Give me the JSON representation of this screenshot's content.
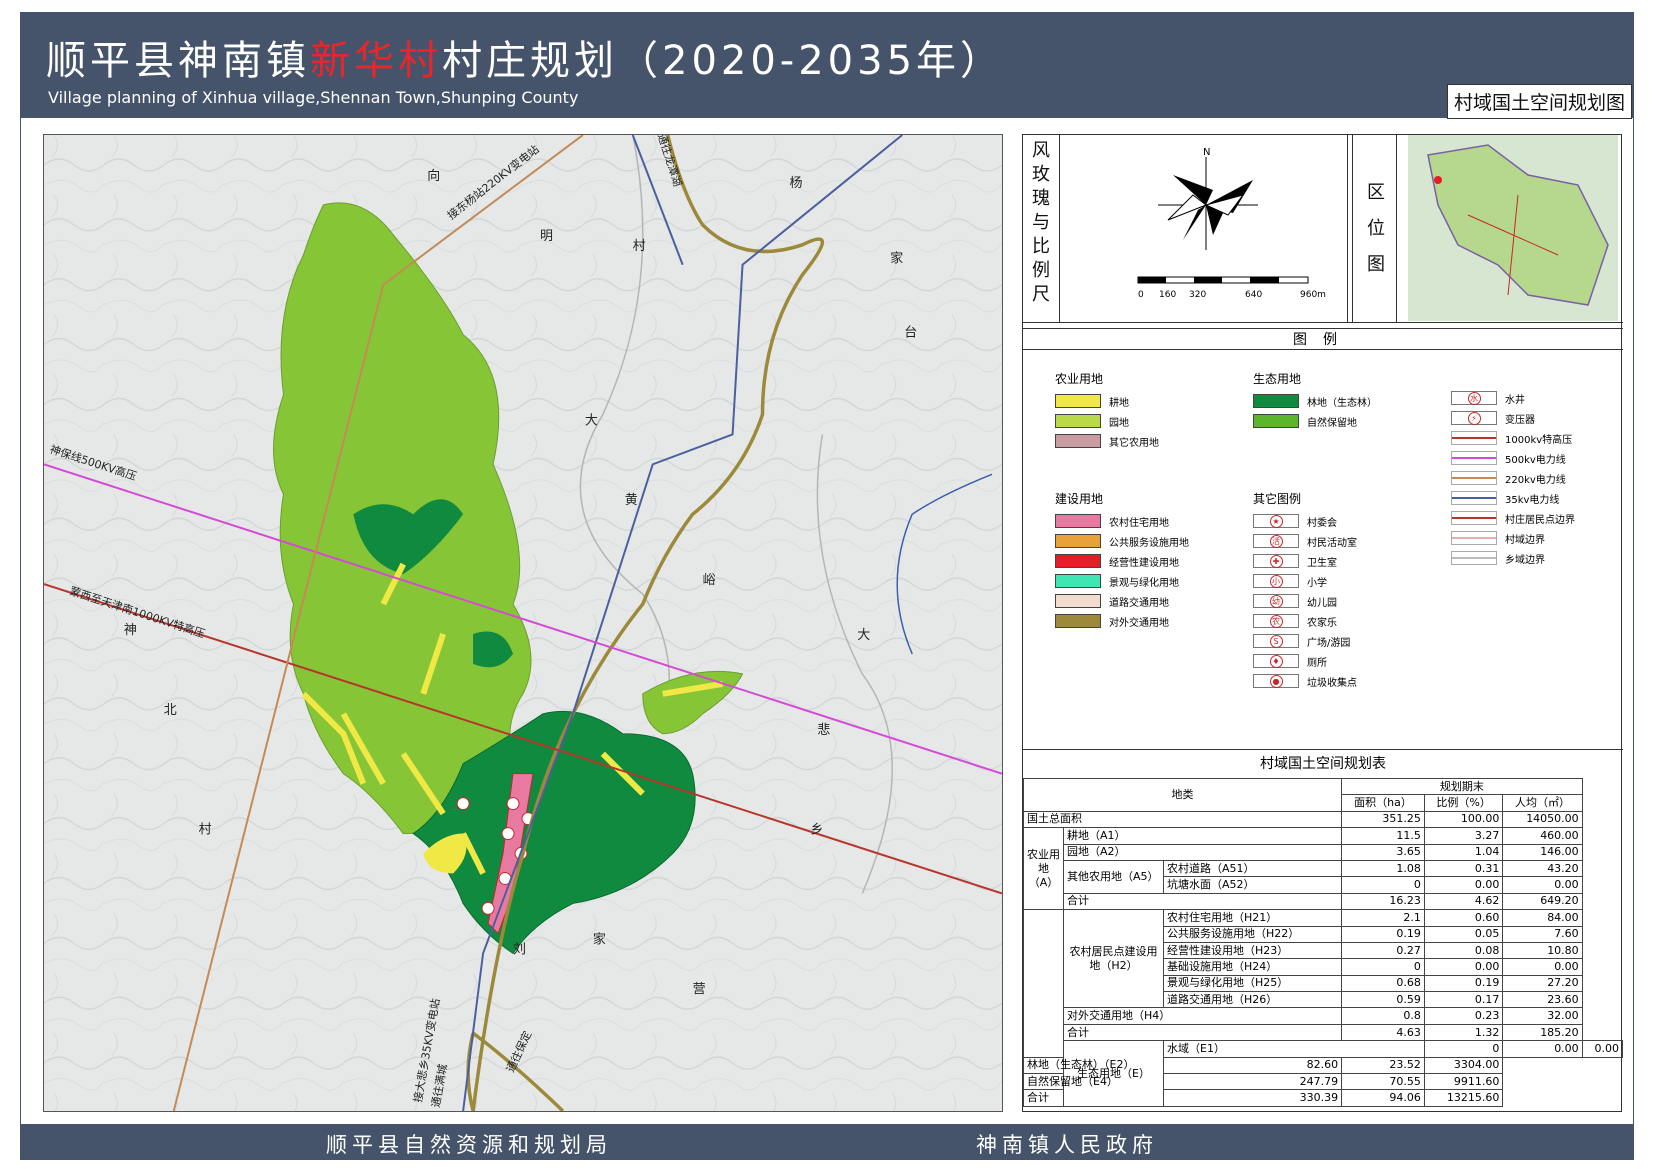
{
  "header": {
    "title_part1": "顺平县神南镇",
    "title_highlight": "新华村",
    "title_part2": "村庄规划（2020-2035年）",
    "subtitle": "Village planning of Xinhua village,Shennan Town,Shunping County",
    "map_type": "村域国土空间规划图"
  },
  "footer": {
    "left": "顺平县自然资源和规划局",
    "right": "神南镇人民政府"
  },
  "map": {
    "colors": {
      "cultivated": "#f0e844",
      "garden": "#9bd136",
      "forest": "#0f8a3e",
      "nature_reserve": "#5cb52c",
      "transport": "#9c8a3a",
      "line_1000kv": "#b8352a",
      "line_500kv": "#d54ad6",
      "line_220kv": "#c58a55",
      "line_35kv": "#4b5fa0",
      "residential": "#e87aa2",
      "public": "#e9a23a",
      "commercial": "#e41e26"
    },
    "place_labels": [
      "向",
      "明",
      "村",
      "杨",
      "家",
      "台",
      "大",
      "黄",
      "峪",
      "大",
      "悲",
      "乡",
      "神",
      "北",
      "村",
      "刘",
      "家",
      "营"
    ],
    "line_labels": [
      "接东杨站220KV变电站",
      "通往龙潭湖",
      "神保线500KV高压",
      "蒙西至天津南1000KV特高压",
      "接大悲乡35KV变电站",
      "通往满城",
      "通往保定"
    ]
  },
  "panel": {
    "rose_label": [
      "风",
      "玫",
      "瑰",
      "与",
      "比",
      "例",
      "尺"
    ],
    "north": "N",
    "scale_ticks": [
      "0",
      "160",
      "320",
      "640",
      "960m"
    ],
    "location_label": [
      "区",
      "位",
      "图"
    ],
    "legend_title": "图例",
    "legend": {
      "agri": {
        "title": "农业用地",
        "items": [
          {
            "label": "耕地",
            "color": "#f0e844"
          },
          {
            "label": "园地",
            "color": "#b9d84a"
          },
          {
            "label": "其它农用地",
            "color": "#c89ca0"
          }
        ]
      },
      "eco": {
        "title": "生态用地",
        "items": [
          {
            "label": "林地（生态林）",
            "color": "#0f8a3e"
          },
          {
            "label": "自然保留地",
            "color": "#5cb52c"
          }
        ]
      },
      "build": {
        "title": "建设用地",
        "items": [
          {
            "label": "农村住宅用地",
            "color": "#e87aa2"
          },
          {
            "label": "公共服务设施用地",
            "color": "#e9a23a"
          },
          {
            "label": "经营性建设用地",
            "color": "#e41e26"
          },
          {
            "label": "景观与绿化用地",
            "color": "#3fe6b4"
          },
          {
            "label": "道路交通用地",
            "color": "#f2dcd0"
          },
          {
            "label": "对外交通用地",
            "color": "#9c8a3a"
          }
        ]
      },
      "other": {
        "title": "其它图例",
        "items": [
          {
            "label": "村委会",
            "glyph": "★"
          },
          {
            "label": "村民活动室",
            "glyph": "活"
          },
          {
            "label": "卫生室",
            "glyph": "✚"
          },
          {
            "label": "小学",
            "glyph": "小"
          },
          {
            "label": "幼儿园",
            "glyph": "幼"
          },
          {
            "label": "农家乐",
            "glyph": "农"
          },
          {
            "label": "广场/游园",
            "glyph": "S"
          },
          {
            "label": "厕所",
            "glyph": "♦"
          },
          {
            "label": "垃圾收集点",
            "glyph": "●"
          }
        ]
      },
      "lines": {
        "items": [
          {
            "label": "水井",
            "glyph": "水",
            "kind": "sym"
          },
          {
            "label": "变压器",
            "glyph": "⚡",
            "kind": "sym"
          },
          {
            "label": "1000kv特高压",
            "color": "#b8352a",
            "kind": "line"
          },
          {
            "label": "500kv电力线",
            "color": "#d54ad6",
            "kind": "line"
          },
          {
            "label": "220kv电力线",
            "color": "#c58a55",
            "kind": "line"
          },
          {
            "label": "35kv电力线",
            "color": "#4b5fa0",
            "kind": "line"
          },
          {
            "label": "村庄居民点边界",
            "color": "#b8352a",
            "kind": "line"
          },
          {
            "label": "村域边界",
            "color": "#e6b0b0",
            "kind": "line"
          },
          {
            "label": "乡域边界",
            "color": "#bdbdbd",
            "kind": "line"
          }
        ]
      }
    },
    "table": {
      "title": "村域国土空间规划表",
      "header": {
        "category": "地类",
        "period": "规划期末",
        "area": "面积（ha）",
        "ratio": "比例（%）",
        "per_capita": "人均（㎡）"
      },
      "total": {
        "label": "国土总面积",
        "area": "351.25",
        "ratio": "100.00",
        "per_capita": "14050.00"
      },
      "agri_group": "农业用地（A）",
      "agri": [
        {
          "name": "耕地（A1）",
          "area": "11.5",
          "ratio": "3.27",
          "per_capita": "460.00"
        },
        {
          "name": "园地（A2）",
          "area": "3.65",
          "ratio": "1.04",
          "per_capita": "146.00"
        },
        {
          "name": "农村道路（A51）",
          "area": "1.08",
          "ratio": "0.31",
          "per_capita": "43.20"
        },
        {
          "name": "坑塘水面（A52）",
          "area": "0",
          "ratio": "0.00",
          "per_capita": "0.00"
        },
        {
          "name": "合计",
          "area": "16.23",
          "ratio": "4.62",
          "per_capita": "649.20"
        }
      ],
      "agri_other_label": "其他农用地（A5）",
      "rural_group": "农村居民点建设用地（H2）",
      "rural": [
        {
          "name": "农村住宅用地（H21）",
          "area": "2.1",
          "ratio": "0.60",
          "per_capita": "84.00"
        },
        {
          "name": "公共服务设施用地（H22）",
          "area": "0.19",
          "ratio": "0.05",
          "per_capita": "7.60"
        },
        {
          "name": "经营性建设用地（H23）",
          "area": "0.27",
          "ratio": "0.08",
          "per_capita": "10.80"
        },
        {
          "name": "基础设施用地（H24）",
          "area": "0",
          "ratio": "0.00",
          "per_capita": "0.00"
        },
        {
          "name": "景观与绿化用地（H25）",
          "area": "0.68",
          "ratio": "0.19",
          "per_capita": "27.20"
        },
        {
          "name": "道路交通用地（H26）",
          "area": "0.59",
          "ratio": "0.17",
          "per_capita": "23.60"
        }
      ],
      "external": {
        "name": "对外交通用地（H4）",
        "area": "0.8",
        "ratio": "0.23",
        "per_capita": "32.00"
      },
      "build_total": {
        "name": "合计",
        "area": "4.63",
        "ratio": "1.32",
        "per_capita": "185.20"
      },
      "eco_group": "生态用地（E）",
      "eco": [
        {
          "name": "水域（E1）",
          "area": "0",
          "ratio": "0.00",
          "per_capita": "0.00"
        },
        {
          "name": "林地（生态林）（E2）",
          "area": "82.60",
          "ratio": "23.52",
          "per_capita": "3304.00"
        },
        {
          "name": "自然保留地（E4）",
          "area": "247.79",
          "ratio": "70.55",
          "per_capita": "9911.60"
        },
        {
          "name": "合计",
          "area": "330.39",
          "ratio": "94.06",
          "per_capita": "13215.60"
        }
      ]
    }
  }
}
